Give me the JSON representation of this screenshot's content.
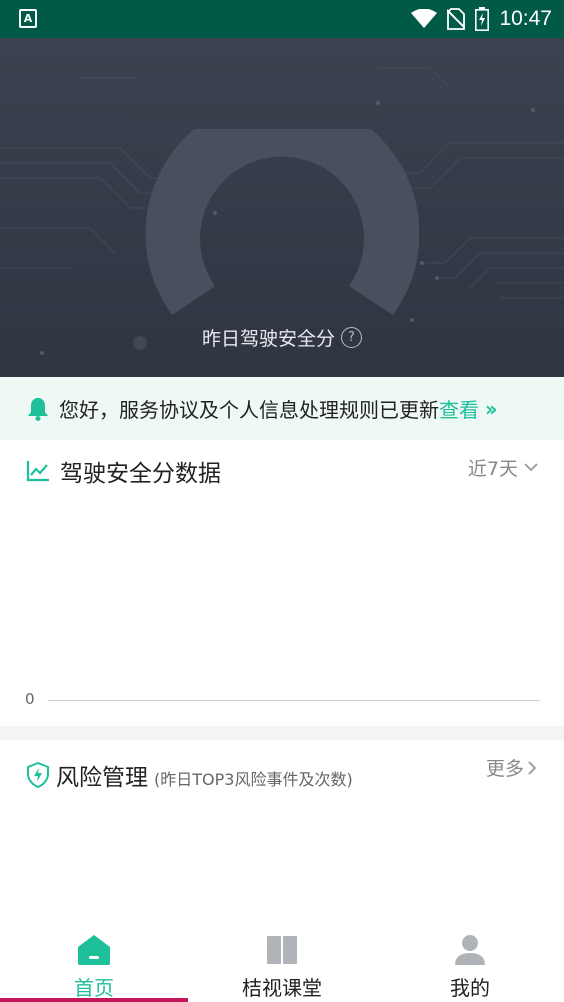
{
  "status_bar": {
    "time": "10:47",
    "left_icon_letter": "A",
    "icons": [
      "wifi-icon",
      "no-sim-icon",
      "battery-charging-icon"
    ]
  },
  "hero": {
    "label": "昨日驾驶安全分",
    "help_symbol": "?"
  },
  "notice": {
    "text": "您好，服务协议及个人信息处理规则已更新",
    "link_label": "查看",
    "arrows": "››",
    "icon": "bell-icon"
  },
  "score_card": {
    "title": "驾驶安全分数据",
    "range_label": "近7天",
    "icon": "line-chart-icon",
    "axis_zero": "0"
  },
  "risk_card": {
    "title": "风险管理",
    "subtitle": "(昨日TOP3风险事件及次数)",
    "more_label": "更多",
    "icon": "shield-icon"
  },
  "nav": {
    "items": [
      {
        "label": "首页",
        "icon": "home-icon",
        "active": true
      },
      {
        "label": "桔视课堂",
        "icon": "book-icon",
        "active": false
      },
      {
        "label": "我的",
        "icon": "user-icon",
        "active": false
      }
    ]
  },
  "colors": {
    "accent": "#1ec09b",
    "status_bar": "#005a45",
    "hero_bg": "#3a404d",
    "nav_indicator": "#c2185b"
  }
}
